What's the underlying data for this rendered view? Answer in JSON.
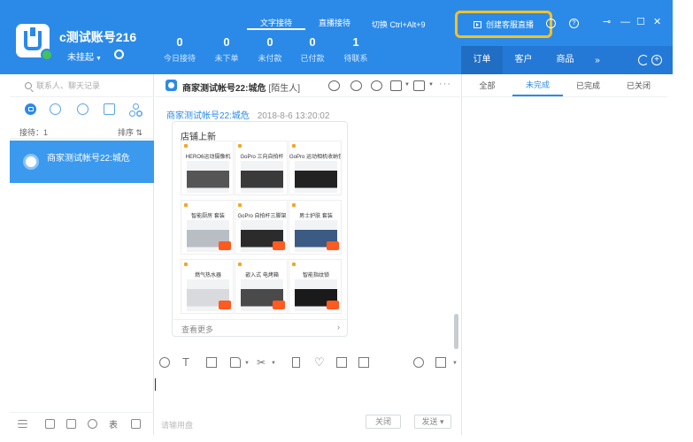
{
  "account": {
    "name": "c测试账号216",
    "status": "未挂起"
  },
  "stats": [
    {
      "value": "0",
      "label": "今日接待"
    },
    {
      "value": "0",
      "label": "未下单"
    },
    {
      "value": "0",
      "label": "未付款"
    },
    {
      "value": "0",
      "label": "已付款"
    },
    {
      "value": "1",
      "label": "待联系"
    }
  ],
  "top_tabs": [
    "文字接待",
    "直播接待"
  ],
  "top_switch": "切换 Ctrl+Alt+9",
  "live_button": "创建客服直播",
  "order_tabs": [
    "订单",
    "客户",
    "商品"
  ],
  "order_more": "»",
  "search": {
    "placeholder": "联系人、聊天记录"
  },
  "sort": {
    "left": "接待：1",
    "right": "排序 ⇅"
  },
  "contact": {
    "name": "商家测试帐号22:城危"
  },
  "chat": {
    "title": "商家测试帐号22:城危",
    "tag": "[陌生人]",
    "sender": "商家测试帐号22:城危",
    "time": "2018-8-6 13:20:02",
    "card_title": "店铺上新",
    "see_more": "查看更多",
    "see_more_arrow": "›"
  },
  "products": [
    {
      "name": "HERO6运动摄像机",
      "color": "#555555"
    },
    {
      "name": "GoPro 三向自拍杆",
      "color": "#3a3a3a"
    },
    {
      "name": "GoPro 运动相机收纳包",
      "color": "#222222"
    },
    {
      "name": "智能厨房 套装",
      "color": "#b9bec4"
    },
    {
      "name": "GoPro 自拍杆三脚架",
      "color": "#2b2b2b"
    },
    {
      "name": "男士护肤 套装",
      "color": "#3b5a84"
    },
    {
      "name": "燃气热水器",
      "color": "#d8dadd"
    },
    {
      "name": "嵌入式 电烤箱",
      "color": "#4a4a4a"
    },
    {
      "name": "智能指纹锁",
      "color": "#1a1a1a"
    }
  ],
  "input": {
    "hint": "请输用盘"
  },
  "buttons": {
    "close": "关闭",
    "send": "发送 ▾"
  },
  "sub_tabs": [
    "全部",
    "未完成",
    "已完成",
    "已关闭"
  ],
  "left_bottom_text": "表",
  "colors": {
    "brand": "#2b8ae8",
    "highlight": "#f5c025",
    "selected": "#3b99ee"
  }
}
